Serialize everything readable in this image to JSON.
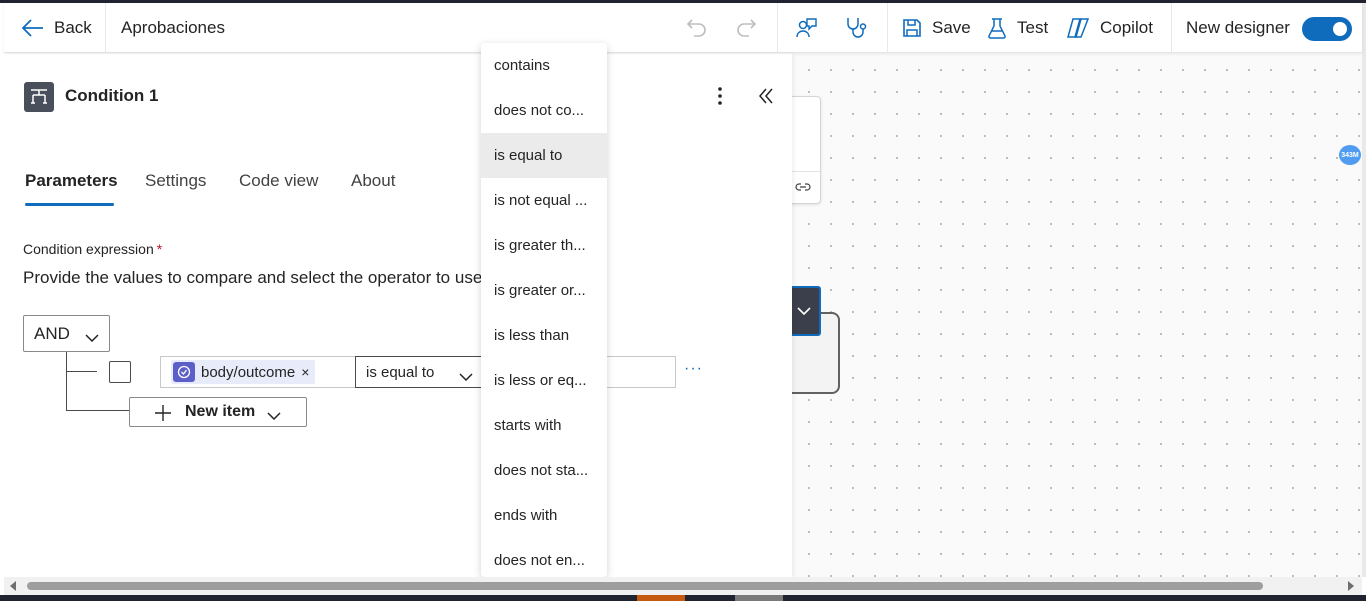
{
  "header": {
    "back_label": "Back",
    "flow_name": "Aprobaciones",
    "save_label": "Save",
    "test_label": "Test",
    "copilot_label": "Copilot",
    "new_designer_label": "New designer",
    "new_designer_on": true
  },
  "panel": {
    "title": "Condition 1",
    "tabs": [
      {
        "label": "Parameters",
        "active": true
      },
      {
        "label": "Settings",
        "active": false
      },
      {
        "label": "Code view",
        "active": false
      },
      {
        "label": "About",
        "active": false
      }
    ],
    "condition_label": "Condition expression",
    "required_marker": "*",
    "condition_description": "Provide the values to compare and select the operator to use.",
    "group_operator": "AND",
    "row": {
      "token_label": "body/outcome",
      "token_remove": "×",
      "operator": "is equal to",
      "value": "",
      "more": "···"
    },
    "new_item_label": "New item"
  },
  "operator_menu": {
    "items": [
      "contains",
      "does not co...",
      "is equal to",
      "is not equal ...",
      "is greater th...",
      "is greater or...",
      "is less than",
      "is less or eq...",
      "starts with",
      "does not sta...",
      "ends with",
      "does not en..."
    ],
    "selected_index": 2
  },
  "canvas": {
    "badge_text": "343M"
  },
  "colors": {
    "accent": "#0f6cbd",
    "token_icon": "#5b5fc7",
    "required": "#c50f1f"
  }
}
